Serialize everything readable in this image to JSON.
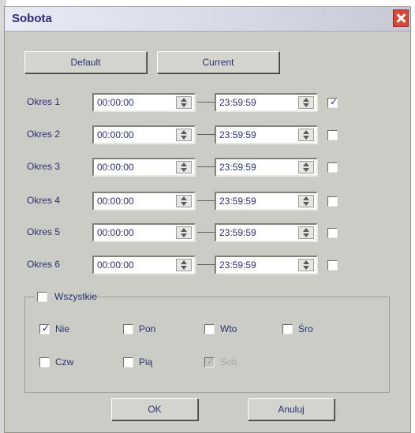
{
  "window": {
    "title": "Sobota"
  },
  "top_buttons": {
    "default_label": "Default",
    "current_label": "Current"
  },
  "periods": [
    {
      "label": "Okres 1",
      "start": "00:00:00",
      "end": "23:59:59",
      "enabled": true
    },
    {
      "label": "Okres 2",
      "start": "00:00:00",
      "end": "23:59:59",
      "enabled": false
    },
    {
      "label": "Okres 3",
      "start": "00:00:00",
      "end": "23:59:59",
      "enabled": false
    },
    {
      "label": "Okres 4",
      "start": "00:00:00",
      "end": "23:59:59",
      "enabled": false
    },
    {
      "label": "Okres 5",
      "start": "00:00:00",
      "end": "23:59:59",
      "enabled": false
    },
    {
      "label": "Okres 6",
      "start": "00:00:00",
      "end": "23:59:59",
      "enabled": false
    }
  ],
  "copy_group": {
    "all_label": "Wszystkie",
    "all_checked": false,
    "days": [
      {
        "label": "Nie",
        "checked": true,
        "disabled": false
      },
      {
        "label": "Pon",
        "checked": false,
        "disabled": false
      },
      {
        "label": "Wto",
        "checked": false,
        "disabled": false
      },
      {
        "label": "Śro",
        "checked": false,
        "disabled": false
      },
      {
        "label": "Czw",
        "checked": false,
        "disabled": false
      },
      {
        "label": "Pią",
        "checked": false,
        "disabled": false
      },
      {
        "label": "Sob",
        "checked": true,
        "disabled": true
      }
    ]
  },
  "footer": {
    "ok_label": "OK",
    "cancel_label": "Anuluj"
  },
  "icons": {
    "close": "close-icon",
    "check": "check-mark-icon",
    "spinner": "spinner-icon"
  },
  "colors": {
    "dialog_bg": "#cbccc6",
    "title_text": "#2d2a7a",
    "close_red": "#d94836"
  }
}
